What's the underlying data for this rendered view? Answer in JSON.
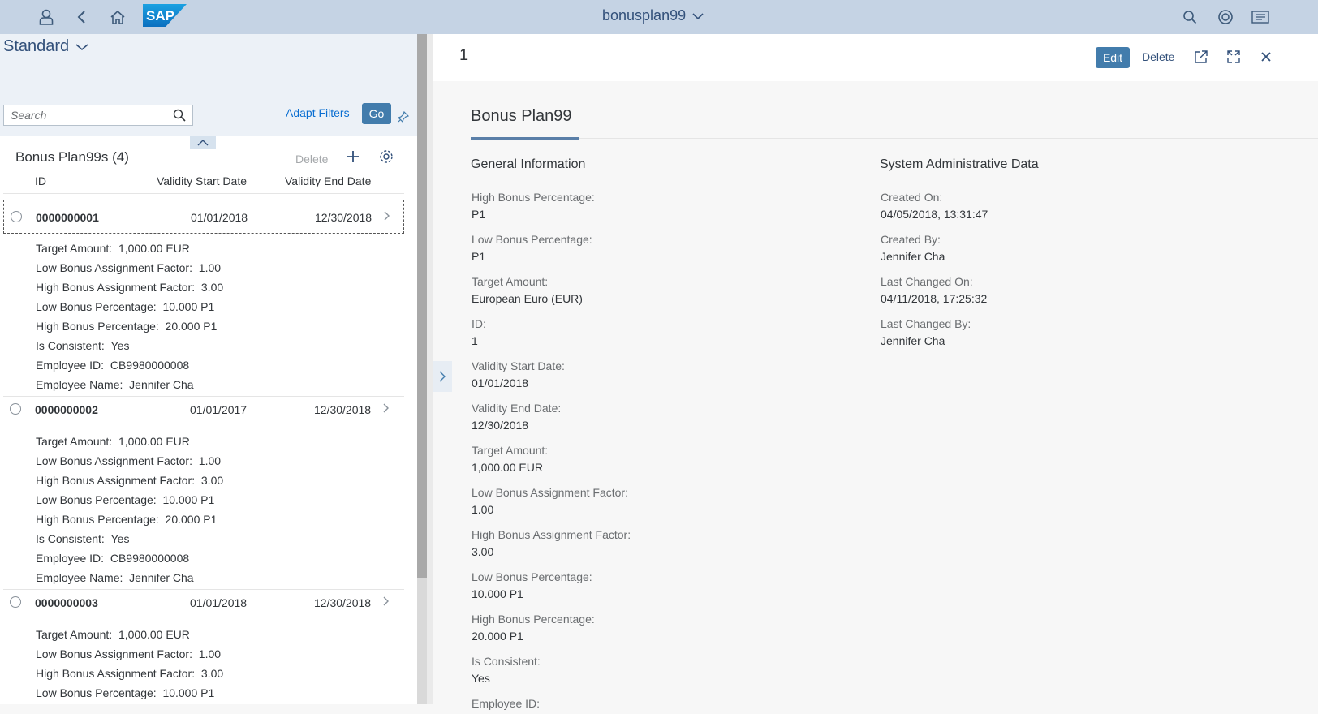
{
  "shell": {
    "title": "bonusplan99",
    "logo_text": "SAP",
    "icons": [
      "user-icon",
      "back-icon",
      "home-icon",
      "search-icon",
      "copilot-icon",
      "notifications-icon"
    ]
  },
  "filter": {
    "variant": "Standard",
    "search_placeholder": "Search",
    "adapt_filters": "Adapt Filters",
    "go": "Go"
  },
  "list": {
    "title": "Bonus Plan99s (4)",
    "delete_label": "Delete",
    "columns": [
      "ID",
      "Validity Start Date",
      "Validity End Date"
    ],
    "items": [
      {
        "id": "0000000001",
        "start": "01/01/2018",
        "end": "12/30/2018",
        "attrs": [
          {
            "label": "Target Amount:",
            "value": "1,000.00  EUR"
          },
          {
            "label": "Low Bonus Assignment Factor:",
            "value": "1.00"
          },
          {
            "label": "High Bonus Assignment Factor:",
            "value": "3.00"
          },
          {
            "label": "Low Bonus Percentage:",
            "value": "10.000  P1"
          },
          {
            "label": "High Bonus Percentage:",
            "value": "20.000  P1"
          },
          {
            "label": "Is Consistent:",
            "value": "Yes"
          },
          {
            "label": "Employee ID:",
            "value": "CB9980000008"
          },
          {
            "label": "Employee Name:",
            "value": "Jennifer Cha"
          }
        ]
      },
      {
        "id": "0000000002",
        "start": "01/01/2017",
        "end": "12/30/2018",
        "attrs": [
          {
            "label": "Target Amount:",
            "value": "1,000.00  EUR"
          },
          {
            "label": "Low Bonus Assignment Factor:",
            "value": "1.00"
          },
          {
            "label": "High Bonus Assignment Factor:",
            "value": "3.00"
          },
          {
            "label": "Low Bonus Percentage:",
            "value": "10.000  P1"
          },
          {
            "label": "High Bonus Percentage:",
            "value": "20.000  P1"
          },
          {
            "label": "Is Consistent:",
            "value": "Yes"
          },
          {
            "label": "Employee ID:",
            "value": "CB9980000008"
          },
          {
            "label": "Employee Name:",
            "value": "Jennifer Cha"
          }
        ]
      },
      {
        "id": "0000000003",
        "start": "01/01/2018",
        "end": "12/30/2018",
        "attrs": [
          {
            "label": "Target Amount:",
            "value": "1,000.00  EUR"
          },
          {
            "label": "Low Bonus Assignment Factor:",
            "value": "1.00"
          },
          {
            "label": "High Bonus Assignment Factor:",
            "value": "3.00"
          },
          {
            "label": "Low Bonus Percentage:",
            "value": "10.000  P1"
          }
        ]
      }
    ]
  },
  "detail": {
    "title": "1",
    "edit": "Edit",
    "delete": "Delete",
    "section_title": "Bonus Plan99",
    "general": {
      "title": "General Information",
      "fields": [
        {
          "label": "High Bonus Percentage:",
          "value": "P1"
        },
        {
          "label": "Low Bonus Percentage:",
          "value": "P1"
        },
        {
          "label": "Target Amount:",
          "value": "European Euro (EUR)"
        },
        {
          "label": "ID:",
          "value": "1"
        },
        {
          "label": "Validity Start Date:",
          "value": "01/01/2018"
        },
        {
          "label": "Validity End Date:",
          "value": "12/30/2018"
        },
        {
          "label": "Target Amount:",
          "value": "1,000.00  EUR"
        },
        {
          "label": "Low Bonus Assignment Factor:",
          "value": "1.00"
        },
        {
          "label": "High Bonus Assignment Factor:",
          "value": "3.00"
        },
        {
          "label": "Low Bonus Percentage:",
          "value": "10.000 P1"
        },
        {
          "label": "High Bonus Percentage:",
          "value": "20.000 P1"
        },
        {
          "label": "Is Consistent:",
          "value": "Yes"
        },
        {
          "label": "Employee ID:",
          "value": ""
        }
      ]
    },
    "admin": {
      "title": "System Administrative Data",
      "fields": [
        {
          "label": "Created On:",
          "value": "04/05/2018, 13:31:47"
        },
        {
          "label": "Created By:",
          "value": "Jennifer Cha"
        },
        {
          "label": "Last Changed On:",
          "value": "04/11/2018, 17:25:32"
        },
        {
          "label": "Last Changed By:",
          "value": "Jennifer Cha"
        }
      ]
    }
  },
  "colors": {
    "shell_bg": "#c5d3e4",
    "accent": "#427cac",
    "link": "#0a6ed1"
  }
}
